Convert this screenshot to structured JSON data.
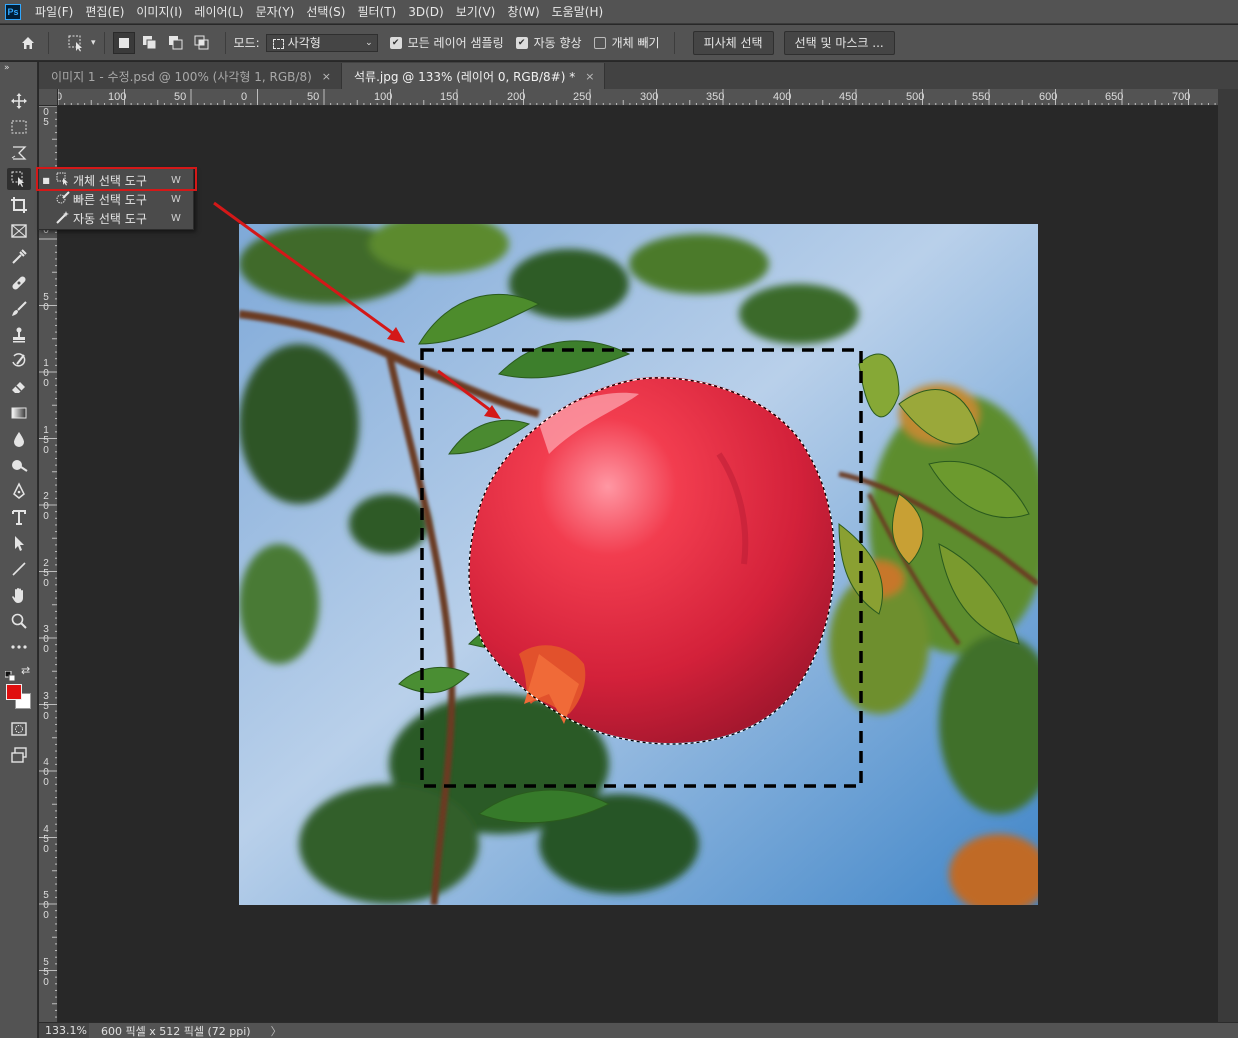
{
  "app": {
    "logo": "Ps"
  },
  "menu": [
    "파일(F)",
    "편집(E)",
    "이미지(I)",
    "레이어(L)",
    "문자(Y)",
    "선택(S)",
    "필터(T)",
    "3D(D)",
    "보기(V)",
    "창(W)",
    "도움말(H)"
  ],
  "options": {
    "mode_label": "모드:",
    "mode_value": "사각형",
    "sample_all_layers": "모든 레이어 샘플링",
    "auto_enhance": "자동 향상",
    "object_subtract": "개체 빼기",
    "select_subject": "피사체 선택",
    "select_and_mask": "선택 및 마스크 ...",
    "sample_all_layers_checked": true,
    "auto_enhance_checked": true,
    "object_subtract_checked": false
  },
  "tabs": [
    {
      "label": "이미지 1 - 수정.psd @ 100% (사각형 1, RGB/8)",
      "close": "×",
      "active": false
    },
    {
      "label": "석류.jpg @ 133% (레이어 0, RGB/8#) *",
      "close": "×",
      "active": true
    }
  ],
  "ruler": {
    "top": [
      "0",
      "100",
      "50",
      "0",
      "50",
      "100",
      "150",
      "200",
      "250",
      "300",
      "350",
      "400",
      "450",
      "500",
      "550",
      "600",
      "650",
      "700"
    ],
    "left": [
      "0",
      "5",
      "0",
      "50",
      "100",
      "150",
      "200",
      "250",
      "300",
      "350",
      "400",
      "450",
      "500",
      "550"
    ]
  },
  "flyout": [
    {
      "name": "개체 선택 도구",
      "key": "W",
      "icon": "object-select-icon",
      "active": true
    },
    {
      "name": "빠른 선택 도구",
      "key": "W",
      "icon": "quick-select-icon",
      "active": false
    },
    {
      "name": "자동 선택 도구",
      "key": "W",
      "icon": "magic-wand-icon",
      "active": false
    }
  ],
  "colors": {
    "foreground": "#e00f0f",
    "background": "#ffffff",
    "annotation": "#d41818"
  },
  "status": {
    "zoom": "133.1%",
    "doc_info": "600 픽셀 x 512 픽셀 (72 ppi)",
    "arrow": "〉"
  }
}
